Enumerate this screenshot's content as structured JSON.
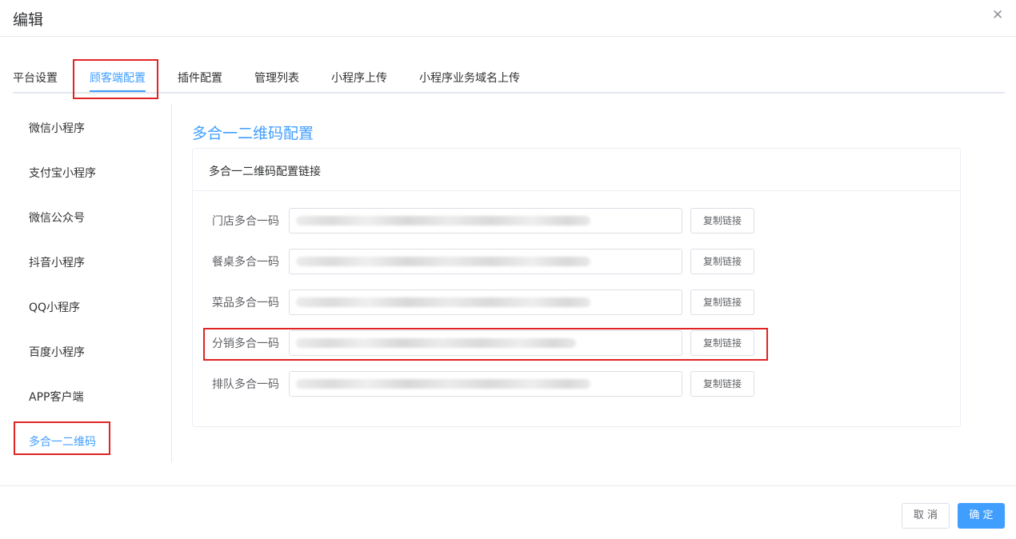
{
  "dialog": {
    "title": "编辑"
  },
  "tabs": [
    {
      "label": "平台设置"
    },
    {
      "label": "顾客端配置"
    },
    {
      "label": "插件配置"
    },
    {
      "label": "管理列表"
    },
    {
      "label": "小程序上传"
    },
    {
      "label": "小程序业务域名上传"
    }
  ],
  "sidebar": {
    "items": [
      {
        "label": "微信小程序"
      },
      {
        "label": "支付宝小程序"
      },
      {
        "label": "微信公众号"
      },
      {
        "label": "抖音小程序"
      },
      {
        "label": "QQ小程序"
      },
      {
        "label": "百度小程序"
      },
      {
        "label": "APP客户端"
      },
      {
        "label": "多合一二维码"
      }
    ]
  },
  "content": {
    "section_title": "多合一二维码配置",
    "card_header": "多合一二维码配置链接",
    "copy_label": "复制链接",
    "fields": [
      {
        "label": "门店多合一码"
      },
      {
        "label": "餐桌多合一码"
      },
      {
        "label": "菜品多合一码"
      },
      {
        "label": "分销多合一码"
      },
      {
        "label": "排队多合一码"
      }
    ]
  },
  "footer": {
    "cancel_label": "取 消",
    "ok_label": "确 定"
  },
  "colors": {
    "accent": "#409eff",
    "highlight": "#e02424"
  },
  "icons": {
    "close": "close-icon"
  }
}
